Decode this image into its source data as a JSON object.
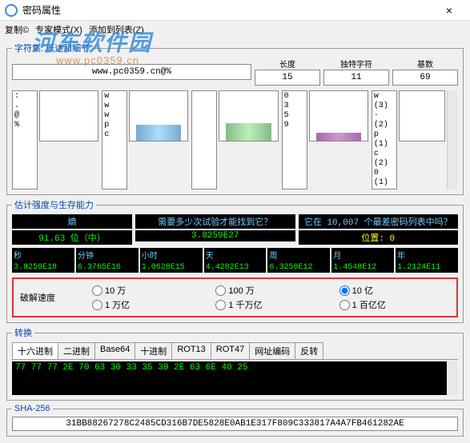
{
  "window": {
    "title": "密码属性",
    "close": "×"
  },
  "menu": {
    "copy": "复制©",
    "mode": "专家模式(X)",
    "add": "添加到列表(Z)"
  },
  "watermark": {
    "line1": "河东软件园",
    "line2": "www.pc0359.cn"
  },
  "charset": {
    "legend": "字符集: 概述和细节",
    "password": "www.pc0359.cn@%",
    "stats": {
      "len_label": "长度",
      "len": "15",
      "uniq_label": "独特字符",
      "uniq": "11",
      "base_label": "基数",
      "base": "69"
    },
    "groups": [
      {
        "list": [
          ":",
          ".",
          "@",
          "%"
        ],
        "counts": []
      },
      {
        "list": [
          "w",
          "w",
          "w",
          "p",
          "c"
        ],
        "counts": []
      },
      {
        "list": [
          ""
        ],
        "counts": [],
        "tiny": true
      },
      {
        "list": [
          "0",
          "3",
          "5",
          "9"
        ],
        "counts": []
      },
      {
        "list": [
          "w",
          "·",
          "p",
          "c",
          "0"
        ],
        "counts": [
          "(3)",
          "(2)",
          "(1)",
          "(2)",
          "(1)"
        ]
      }
    ]
  },
  "estimate": {
    "legend": "估计强度与生存能力",
    "entropy_label": "熵",
    "entropy": "91.63 位（中）",
    "attempts_label": "需要多少次试验才能找到它？",
    "attempts": "3.8259E27",
    "worst_label": "它在 10,007 个最差密码列表中吗？",
    "worst": "位置: 0",
    "times": [
      {
        "label": "秒",
        "val": "3.8259E18"
      },
      {
        "label": "分钟",
        "val": "6.3765E16"
      },
      {
        "label": "小时",
        "val": "1.0628E15"
      },
      {
        "label": "天",
        "val": "4.4282E13"
      },
      {
        "label": "周",
        "val": "6.3259E12"
      },
      {
        "label": "月",
        "val": "1.4548E12"
      },
      {
        "label": "年",
        "val": "1.2124E11"
      }
    ],
    "speed_label": "破解速度",
    "speeds": [
      {
        "label": "10 万",
        "checked": false
      },
      {
        "label": "100 万",
        "checked": false
      },
      {
        "label": "10 亿",
        "checked": true
      },
      {
        "label": "1 万亿",
        "checked": false
      },
      {
        "label": "1 千万亿",
        "checked": false
      },
      {
        "label": "1 百亿亿",
        "checked": false
      }
    ]
  },
  "convert": {
    "legend": "转换",
    "tabs": [
      "十六进制",
      "二进制",
      "Base64",
      "十进制",
      "ROT13",
      "ROT47",
      "网址编码",
      "反转"
    ],
    "active": 0,
    "output": "77 77 77 2E 70 63 30 33 35 39 2E 63 6E 40 25"
  },
  "sha": {
    "legend": "SHA-256",
    "value": "31BB88267278C2485CD316B7DE5828E0AB1E317F809C333817A4A7FB461282AE"
  }
}
